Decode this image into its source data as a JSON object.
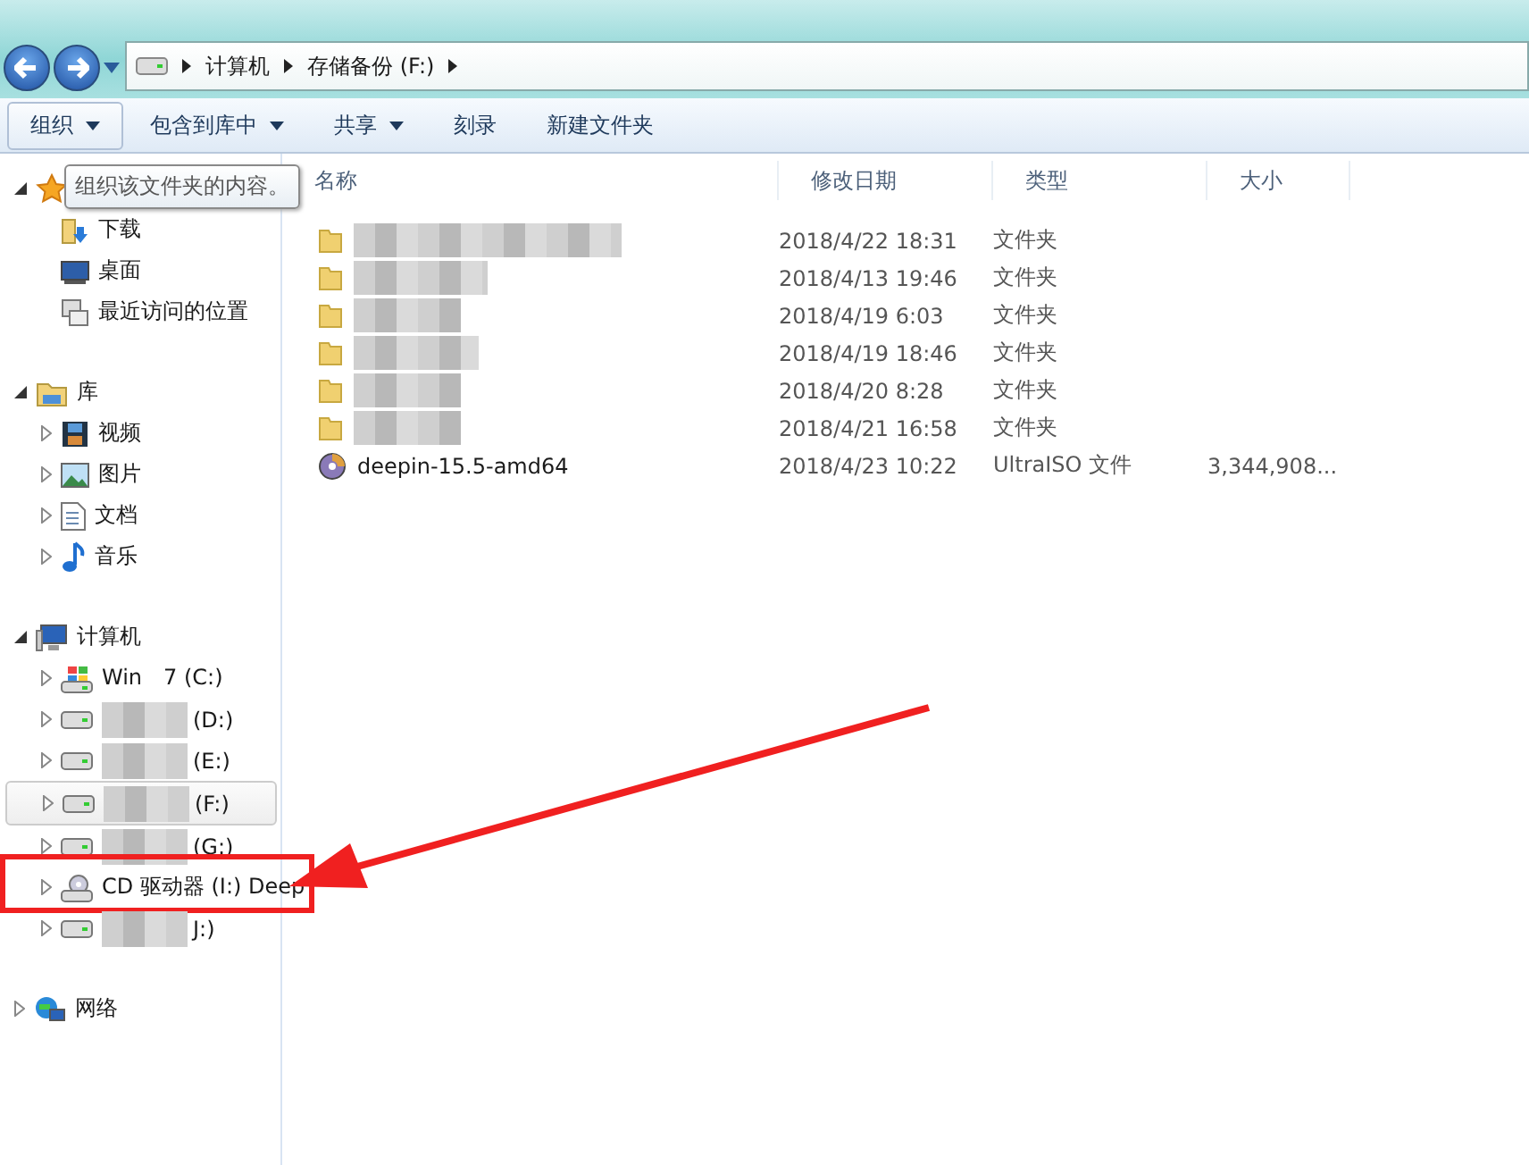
{
  "address": {
    "crumbs": [
      "计算机",
      "存储备份 (F:)"
    ]
  },
  "toolbar": [
    {
      "label": "组织",
      "dropdown": true
    },
    {
      "label": "包含到库中",
      "dropdown": true
    },
    {
      "label": "共享",
      "dropdown": true
    },
    {
      "label": "刻录",
      "dropdown": false
    },
    {
      "label": "新建文件夹",
      "dropdown": false
    }
  ],
  "tooltip": "组织该文件夹的内容。",
  "nav": [
    {
      "kind": "favorites",
      "expanded": true,
      "children": [
        {
          "kind": "download",
          "label": "下载"
        },
        {
          "kind": "desktop",
          "label": "桌面"
        },
        {
          "kind": "recent",
          "label": "最近访问的位置"
        }
      ]
    },
    {
      "kind": "library",
      "label": "库",
      "expanded": true,
      "children": [
        {
          "kind": "video",
          "label": "视频"
        },
        {
          "kind": "picture",
          "label": "图片"
        },
        {
          "kind": "doc",
          "label": "文档"
        },
        {
          "kind": "music",
          "label": "音乐"
        }
      ]
    },
    {
      "kind": "computer",
      "label": "计算机",
      "expanded": true,
      "children": [
        {
          "kind": "windrive",
          "label": "Win　7 (C:)",
          "blurred": false,
          "selected": false
        },
        {
          "kind": "drive",
          "label": "(D:)",
          "blurred": true,
          "selected": false
        },
        {
          "kind": "drive",
          "label": "(E:)",
          "blurred": true,
          "selected": false
        },
        {
          "kind": "drive",
          "label": "(F:)",
          "blurred": true,
          "selected": true
        },
        {
          "kind": "drive",
          "label": "(G:)",
          "blurred": true,
          "selected": false
        },
        {
          "kind": "cd",
          "label": "CD 驱动器 (I:) Deep",
          "blurred": false,
          "selected": false,
          "highlighted": true
        },
        {
          "kind": "drive",
          "label": "J:)",
          "blurred": true,
          "selected": false
        }
      ]
    },
    {
      "kind": "network",
      "label": "网络",
      "expanded": false
    }
  ],
  "table": {
    "columns": [
      "名称",
      "修改日期",
      "类型",
      "大小"
    ],
    "rows": [
      {
        "kind": "folder",
        "date": "2018/4/22 18:31",
        "type": "文件夹"
      },
      {
        "kind": "folder",
        "date": "2018/4/13 19:46",
        "type": "文件夹"
      },
      {
        "kind": "folder",
        "date": "2018/4/19 6:03",
        "type": "文件夹"
      },
      {
        "kind": "folder",
        "date": "2018/4/19 18:46",
        "type": "文件夹"
      },
      {
        "kind": "folder",
        "date": "2018/4/20 8:28",
        "type": "文件夹"
      },
      {
        "kind": "folder",
        "date": "2018/4/21 16:58",
        "type": "文件夹"
      },
      {
        "kind": "iso",
        "name": "deepin-15.5-amd64",
        "date": "2018/4/23 10:22",
        "type": "UltraISO 文件",
        "size": "3,344,908..."
      }
    ]
  }
}
